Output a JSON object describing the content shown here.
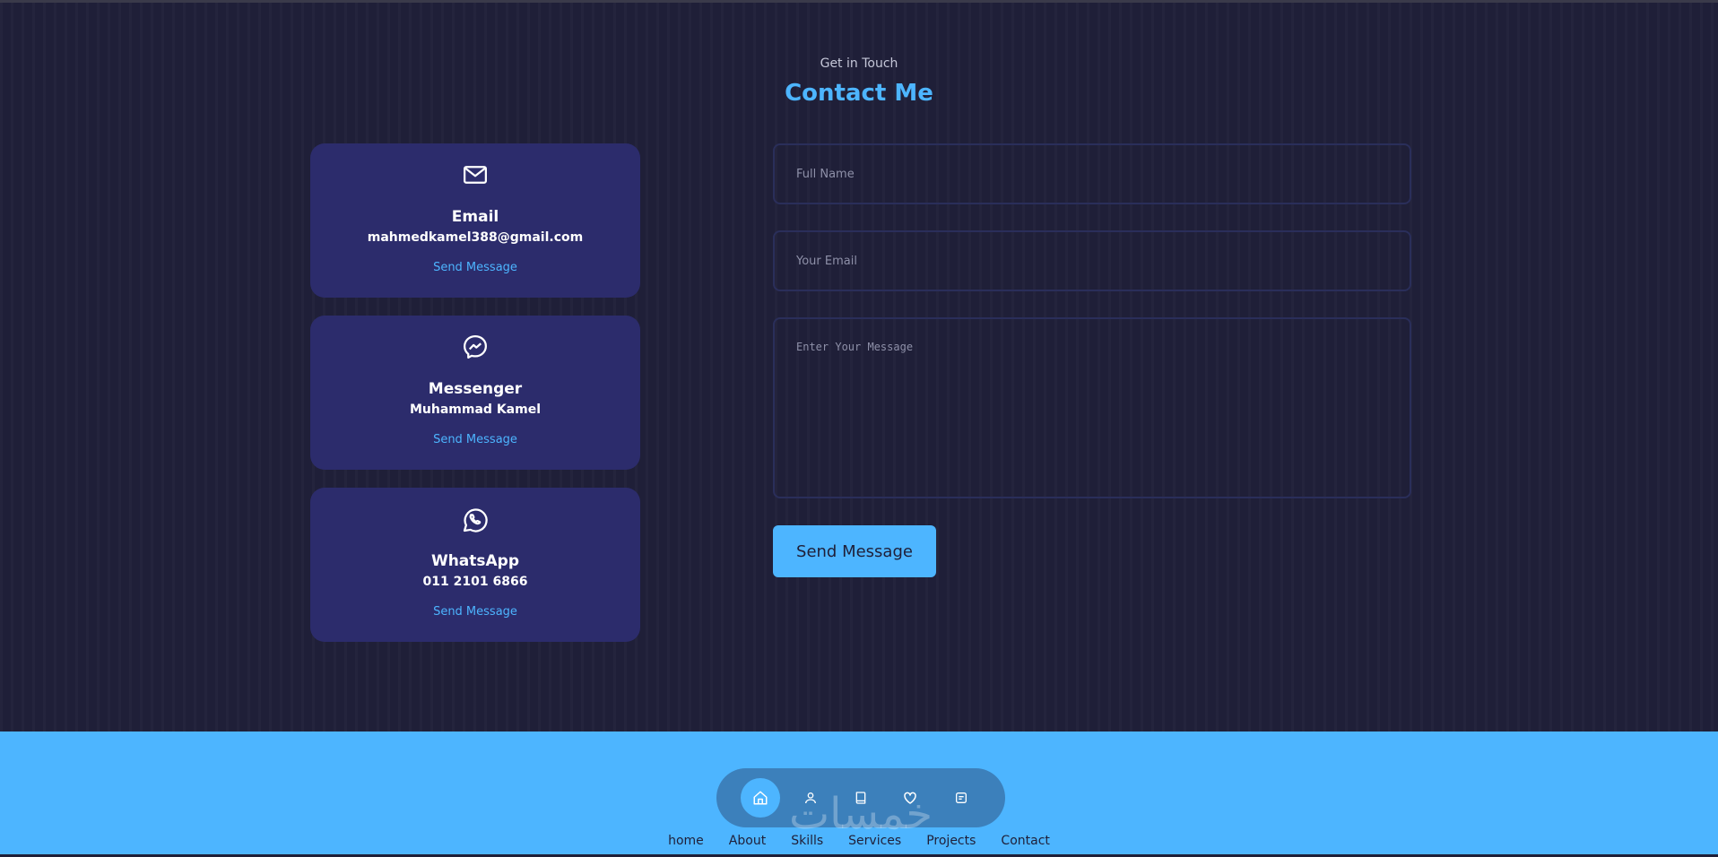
{
  "header": {
    "subtitle": "Get in Touch",
    "title": "Contact Me"
  },
  "cards": [
    {
      "icon": "mail-icon",
      "name": "Email",
      "detail": "mahmedkamel388@gmail.com",
      "link": "Send Message"
    },
    {
      "icon": "messenger-icon",
      "name": "Messenger",
      "detail": "Muhammad Kamel",
      "link": "Send Message"
    },
    {
      "icon": "whatsapp-icon",
      "name": "WhatsApp",
      "detail": "011 2101 6866",
      "link": "Send Message"
    }
  ],
  "form": {
    "name_placeholder": "Full Name",
    "email_placeholder": "Your Email",
    "message_placeholder": "Enter Your Message",
    "submit_label": "Send Message"
  },
  "bottom_nav": {
    "icons": [
      "home-icon",
      "user-icon",
      "book-icon",
      "services-icon",
      "message-square-icon"
    ],
    "active": "home-icon"
  },
  "watermark": "خمسات",
  "footer_links": [
    "home",
    "About",
    "Skills",
    "Services",
    "Projects",
    "Contact"
  ],
  "colors": {
    "background": "#1f1f38",
    "card": "#2c2c6c",
    "accent": "#4db5ff"
  }
}
